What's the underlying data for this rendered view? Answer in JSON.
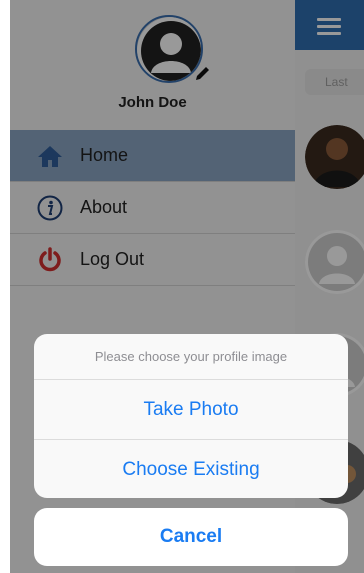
{
  "profile": {
    "name": "John Doe"
  },
  "menu": {
    "items": [
      {
        "label": "Home",
        "icon": "home-icon",
        "active": true
      },
      {
        "label": "About",
        "icon": "info-icon",
        "active": false
      },
      {
        "label": "Log Out",
        "icon": "power-icon",
        "active": false
      }
    ]
  },
  "content": {
    "search_placeholder": "Last"
  },
  "action_sheet": {
    "title": "Please choose your profile image",
    "options": [
      "Take Photo",
      "Choose Existing"
    ],
    "cancel_label": "Cancel"
  },
  "colors": {
    "accent": "#2f6fb1",
    "action_blue": "#1a7cf2",
    "power_red": "#d32f2f"
  }
}
